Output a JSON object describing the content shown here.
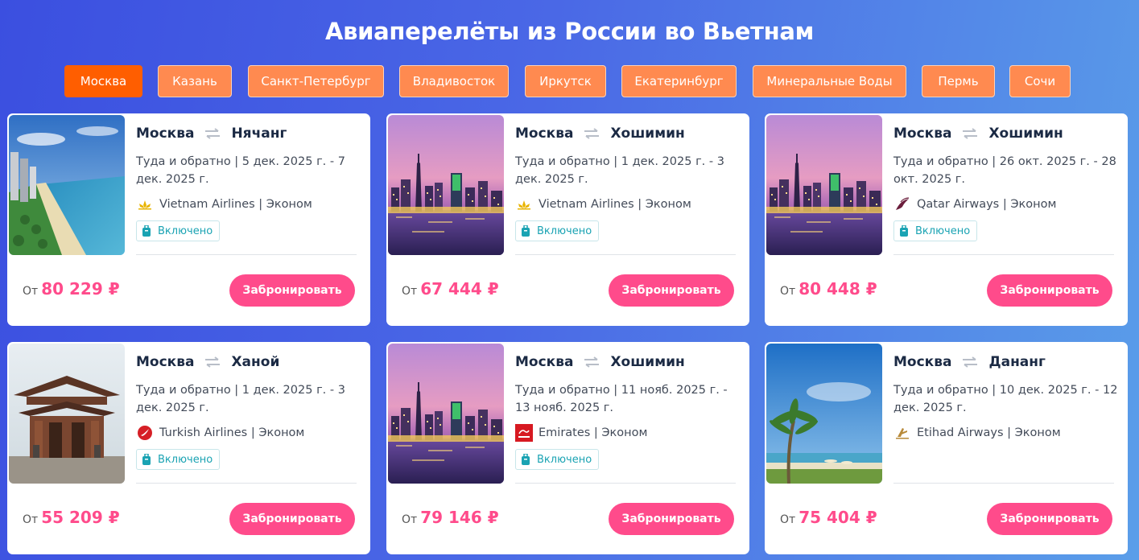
{
  "title": "Авиаперелёты из России во Вьетнам",
  "cities": [
    "Москва",
    "Казань",
    "Санкт-Петербург",
    "Владивосток",
    "Иркутск",
    "Екатеринбург",
    "Минеральные Воды",
    "Пермь",
    "Сочи"
  ],
  "active_city": "Москва",
  "cards": [
    {
      "from": "Москва",
      "to": "Нячанг",
      "dates": "Туда и обратно | 5 дек. 2025 г. - 7 дек. 2025 г.",
      "airline": "Vietnam Airlines | Эконом",
      "logo_icon": "vietnam-airlines-lotus-icon",
      "photo": "beach-city",
      "baggage": "Включено",
      "price_prefix": "От",
      "price": "80 229 ₽",
      "button": "Забронировать"
    },
    {
      "from": "Москва",
      "to": "Хошимин",
      "dates": "Туда и обратно | 1 дек. 2025 г. - 3 дек. 2025 г.",
      "airline": "Vietnam Airlines | Эконом",
      "logo_icon": "vietnam-airlines-lotus-icon",
      "photo": "city-night",
      "baggage": "Включено",
      "price_prefix": "От",
      "price": "67 444 ₽",
      "button": "Забронировать"
    },
    {
      "from": "Москва",
      "to": "Хошимин",
      "dates": "Туда и обратно | 26 окт. 2025 г. - 28 окт. 2025 г.",
      "airline": "Qatar Airways | Эконом",
      "logo_icon": "qatar-oryx-icon",
      "photo": "city-night",
      "baggage": "Включено",
      "price_prefix": "От",
      "price": "80 448 ₽",
      "button": "Забронировать"
    },
    {
      "from": "Москва",
      "to": "Ханой",
      "dates": "Туда и обратно | 1 дек. 2025 г. - 3 дек. 2025 г.",
      "airline": "Turkish Airlines | Эконом",
      "logo_icon": "turkish-airlines-icon",
      "photo": "temple",
      "baggage": "Включено",
      "price_prefix": "От",
      "price": "55 209 ₽",
      "button": "Забронировать"
    },
    {
      "from": "Москва",
      "to": "Хошимин",
      "dates": "Туда и обратно | 11 нояб. 2025 г. - 13 нояб. 2025 г.",
      "airline": "Emirates | Эконом",
      "logo_icon": "emirates-icon",
      "photo": "city-night",
      "baggage": "Включено",
      "price_prefix": "От",
      "price": "79 146 ₽",
      "button": "Забронировать"
    },
    {
      "from": "Москва",
      "to": "Дананг",
      "dates": "Туда и обратно | 10 дек. 2025 г. - 12 дек. 2025 г.",
      "airline": "Etihad Airways | Эконом",
      "logo_icon": "etihad-icon",
      "photo": "palm-beach",
      "baggage": null,
      "price_prefix": "От",
      "price": "75 404 ₽",
      "button": "Забронировать"
    }
  ]
}
